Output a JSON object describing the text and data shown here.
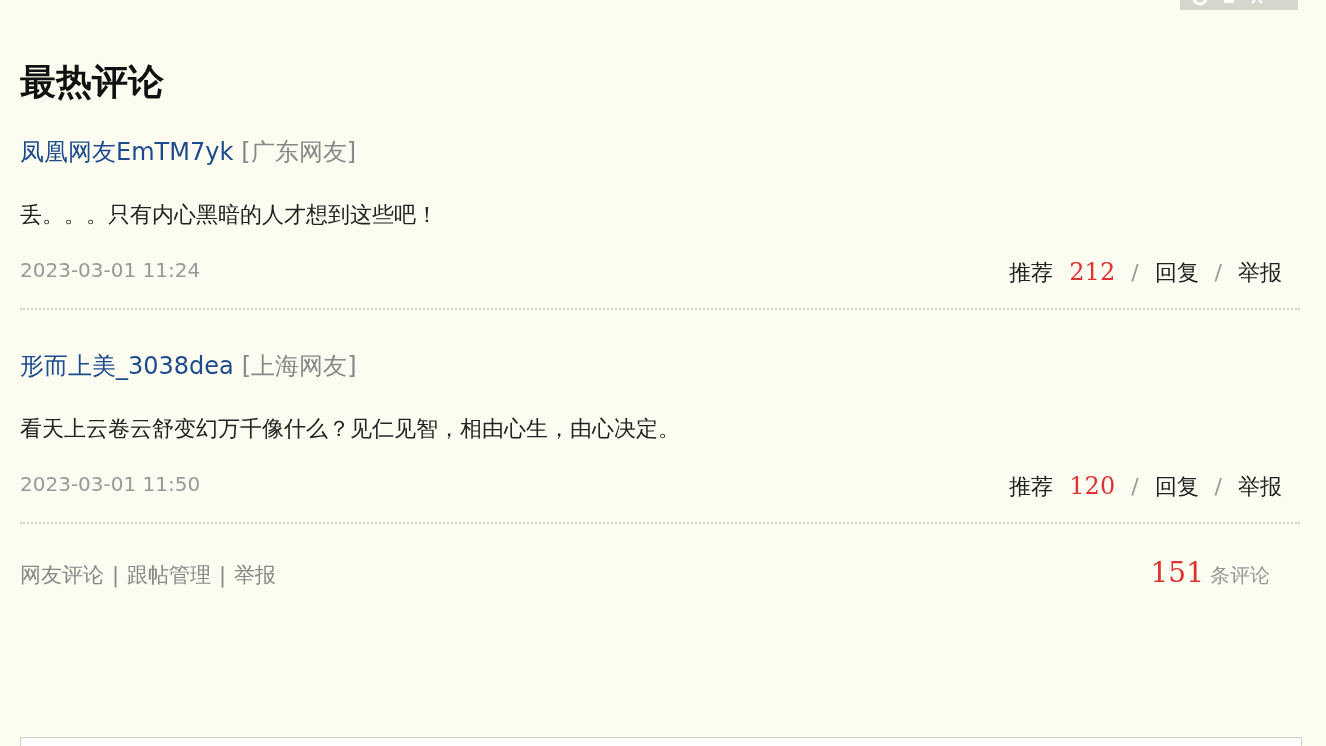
{
  "title": "最热评论",
  "comments": [
    {
      "user": "凤凰网友EmTM7yk",
      "location": "[广东网友]",
      "content": "丢。。。只有内心黑暗的人才想到这些吧！",
      "time": "2023-03-01 11:24",
      "recommend_label": "推荐",
      "recommend_count": "212",
      "separator_1": "/",
      "reply": "回复",
      "separator_2": "/",
      "report": "举报"
    },
    {
      "user": "形而上美_3038dea",
      "location": "[上海网友]",
      "content": "看天上云卷云舒变幻万千像什么？见仁见智，相由心生，由心决定。",
      "time": "2023-03-01 11:50",
      "recommend_label": "推荐",
      "recommend_count": "120",
      "separator_1": "/",
      "reply": "回复",
      "separator_2": "/",
      "report": "举报"
    }
  ],
  "footer": {
    "links": [
      {
        "label": "网友评论"
      },
      {
        "label": "跟帖管理"
      },
      {
        "label": "举报"
      }
    ],
    "separators": [
      "|",
      "|"
    ],
    "comment_count": "151",
    "comment_count_label": "条评论"
  }
}
